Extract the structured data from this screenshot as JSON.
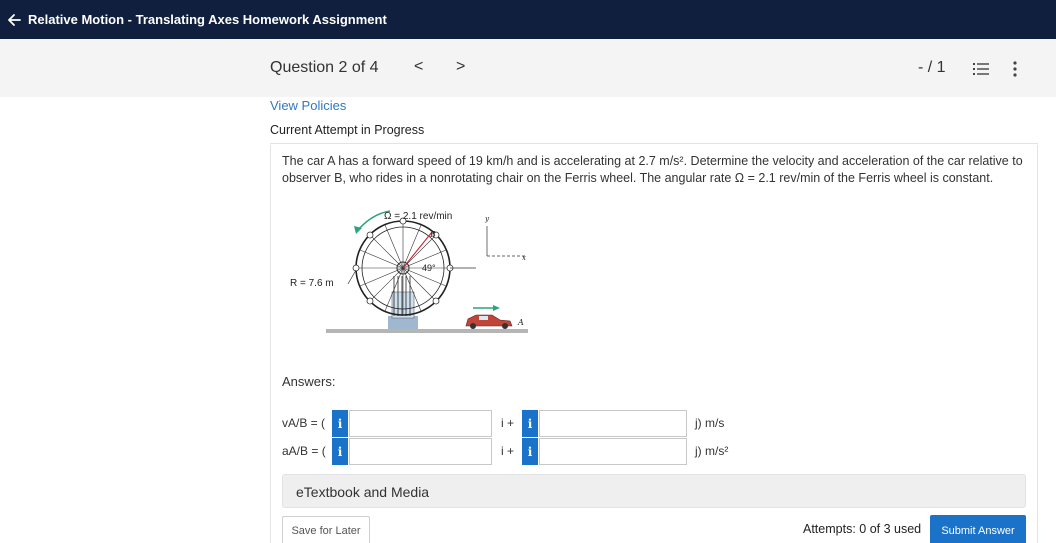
{
  "header": {
    "title": "Relative Motion - Translating Axes Homework Assignment"
  },
  "question_bar": {
    "label": "Question 2 of 4",
    "prev": "<",
    "next": ">",
    "score": "- / 1"
  },
  "links": {
    "view_policies": "View Policies"
  },
  "status": {
    "attempt": "Current Attempt in Progress"
  },
  "problem": {
    "statement": "The car A has a forward speed of 19 km/h and is accelerating at 2.7 m/s². Determine the velocity and acceleration of the car relative to observer B, who rides in a nonrotating chair on the Ferris wheel. The angular rate Ω = 2.1 rev/min of the Ferris wheel is constant.",
    "figure": {
      "omega_label": "Ω = 2.1 rev/min",
      "radius_label": "R = 7.6 m",
      "angle_label": "49°",
      "point_b": "B",
      "point_a": "A",
      "axis_x": "x",
      "axis_y": "y"
    }
  },
  "answers": {
    "heading": "Answers:",
    "rows": [
      {
        "label": "vA/B = (",
        "i_label": "i",
        "mid": "i +",
        "value1": "",
        "value2": "",
        "unit": "j) m/s"
      },
      {
        "label": "aA/B = (",
        "i_label": "i",
        "mid": "i +",
        "value1": "",
        "value2": "",
        "unit": "j) m/s²"
      }
    ]
  },
  "etextbook": {
    "label": "eTextbook and Media"
  },
  "footer": {
    "save_label": "Save for Later",
    "attempts": "Attempts: 0 of 3 used",
    "submit_label": "Submit Answer"
  },
  "colors": {
    "header_bg": "#0f1f3d",
    "accent": "#1a73c9",
    "link": "#2f79c0"
  },
  "icons": {
    "back": "arrow-left-icon",
    "list": "list-icon",
    "menu": "more-vertical-icon",
    "info": "info-icon"
  }
}
